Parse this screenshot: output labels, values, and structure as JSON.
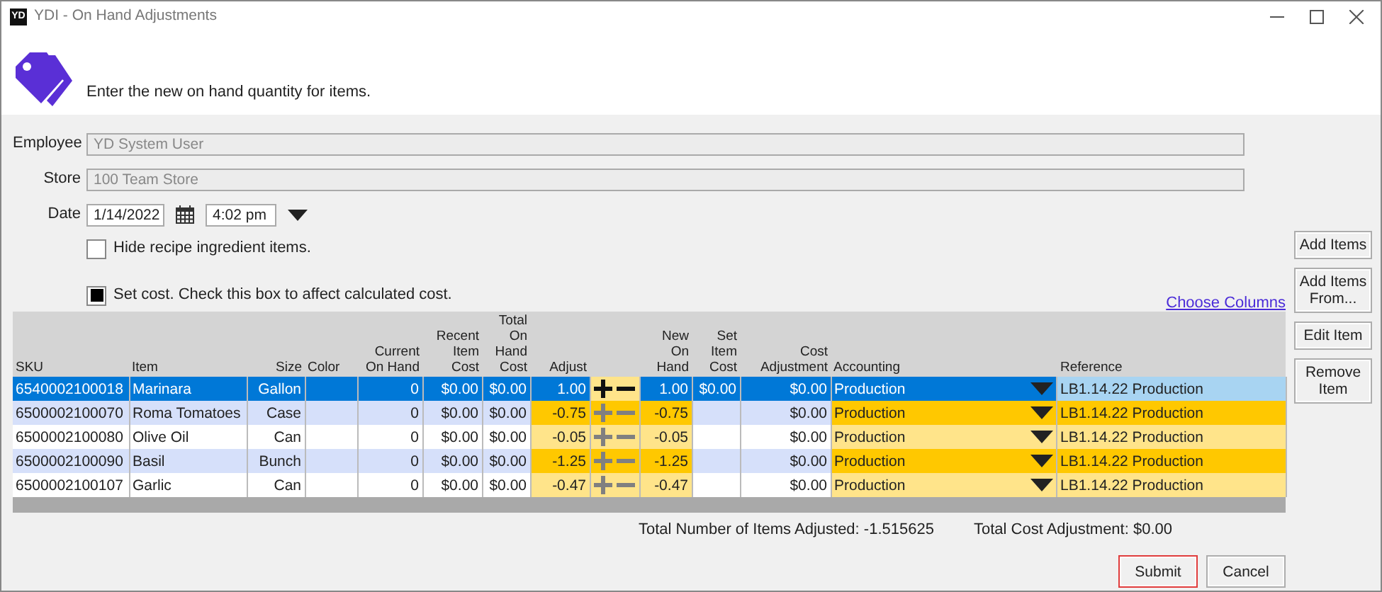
{
  "window": {
    "logo": "YD",
    "title": "YDI - On Hand Adjustments"
  },
  "header": {
    "instruction": "Enter the new on hand quantity for items."
  },
  "form": {
    "fields": [
      {
        "label": "Employee",
        "value": "YD System User",
        "disabled": true
      },
      {
        "label": "Store",
        "value": "100 Team Store",
        "disabled": true
      }
    ],
    "date": {
      "label": "Date",
      "value": "1/14/2022",
      "time": "4:02 pm"
    },
    "options": [
      {
        "label": "Hide recipe ingredient items.",
        "checked": false
      },
      {
        "label": "Set cost. Check this box to affect calculated cost.",
        "checked": true
      }
    ],
    "choose_columns_link": "Choose Columns"
  },
  "table": {
    "columns": [
      {
        "label": "SKU",
        "kind": "text"
      },
      {
        "label": "Item",
        "kind": "text"
      },
      {
        "label": "Size",
        "kind": "number"
      },
      {
        "label": "Color",
        "kind": "text"
      },
      {
        "label": "Current On Hand",
        "kind": "number"
      },
      {
        "label": "Recent Item Cost",
        "kind": "number"
      },
      {
        "label": "Total On Hand Cost",
        "kind": "number"
      },
      {
        "label": "Adjust",
        "kind": "stepper"
      },
      {
        "label": "New On Hand",
        "kind": "number"
      },
      {
        "label": "Set Item Cost",
        "kind": "number"
      },
      {
        "label": "Cost Adjustment",
        "kind": "number"
      },
      {
        "label": "Accounting",
        "kind": "dropdown"
      },
      {
        "label": "Reference",
        "kind": "text"
      }
    ],
    "rows": [
      {
        "selected": true,
        "sku": "6540002100018",
        "item": "Marinara",
        "size": "Gallon",
        "current_on_hand": "0",
        "recent_item_cost": "$0.00",
        "total_on_hand_cost": "$0.00",
        "adjust": "1.00",
        "new_on_hand": "1.00",
        "set_item_cost": "$0.00",
        "cost_adjustment": "$0.00",
        "accounting": "Production",
        "reference": "LB1.14.22 Production"
      },
      {
        "selected": false,
        "sku": "6500002100070",
        "item": "Roma Tomatoes",
        "size": "Case",
        "current_on_hand": "0",
        "recent_item_cost": "$0.00",
        "total_on_hand_cost": "$0.00",
        "adjust": "-0.75",
        "new_on_hand": "-0.75",
        "cost_adjustment": "$0.00",
        "accounting": "Production",
        "reference": "LB1.14.22 Production"
      },
      {
        "selected": false,
        "sku": "6500002100080",
        "item": "Olive Oil",
        "size": "Can",
        "current_on_hand": "0",
        "recent_item_cost": "$0.00",
        "total_on_hand_cost": "$0.00",
        "adjust": "-0.05",
        "new_on_hand": "-0.05",
        "cost_adjustment": "$0.00",
        "accounting": "Production",
        "reference": "LB1.14.22 Production"
      },
      {
        "selected": false,
        "sku": "6500002100090",
        "item": "Basil",
        "size": "Bunch",
        "current_on_hand": "0",
        "recent_item_cost": "$0.00",
        "total_on_hand_cost": "$0.00",
        "adjust": "-1.25",
        "new_on_hand": "-1.25",
        "cost_adjustment": "$0.00",
        "accounting": "Production",
        "reference": "LB1.14.22 Production"
      },
      {
        "selected": false,
        "sku": "6500002100107",
        "item": "Garlic",
        "size": "Can",
        "current_on_hand": "0",
        "recent_item_cost": "$0.00",
        "total_on_hand_cost": "$0.00",
        "adjust": "-0.47",
        "new_on_hand": "-0.47",
        "cost_adjustment": "$0.00",
        "accounting": "Production",
        "reference": "LB1.14.22 Production"
      }
    ]
  },
  "side_buttons": [
    "Add Items",
    "Add Items From...",
    "Edit Item",
    "Remove Item"
  ],
  "totals": {
    "items": "Total Number of Items Adjusted: -1.515625",
    "cost": "Total Cost Adjustment: $0.00"
  },
  "footer_buttons": [
    {
      "label": "Submit",
      "focused": true
    },
    {
      "label": "Cancel",
      "focused": false
    }
  ]
}
